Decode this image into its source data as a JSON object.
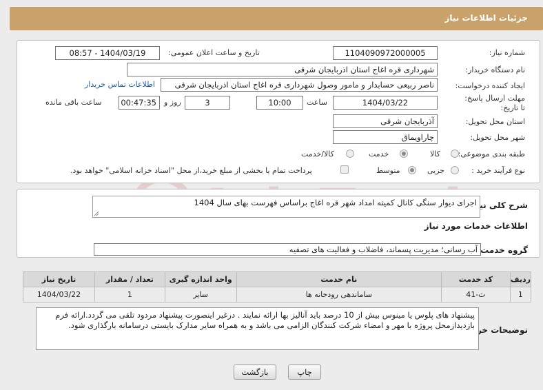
{
  "header": {
    "title": "جزئیات اطلاعات نیاز"
  },
  "form": {
    "need_number_label": "شماره نیاز:",
    "need_number": "1104090972000005",
    "announce_label": "تاریخ و ساعت اعلان عمومی:",
    "announce_value": "1404/03/19 - 08:57",
    "buyer_label": "نام دستگاه خریدار:",
    "buyer_value": "شهرداری قره اغاج استان اذربایجان شرقی",
    "creator_label": "ایجاد کننده درخواست:",
    "creator_value": "ناصر  ربیعی  حسابدار و مامور وصول  شهرداری قره اغاج استان اذربایجان شرقی",
    "contact_link": "اطلاعات تماس خریدار",
    "deadline_label": "مهلت ارسال پاسخ: تا تاریخ:",
    "deadline_date": "1404/03/22",
    "time_label": "ساعت",
    "deadline_time": "10:00",
    "days_value": "3",
    "days_label": "روز و",
    "remaining_value": "00:47:35",
    "remaining_label": "ساعت باقی مانده",
    "province_label": "استان محل تحویل:",
    "province_value": "آذربایجان شرقی",
    "city_label": "شهر محل تحویل:",
    "city_value": "چاراویماق",
    "category_label": "طبقه بندی موضوعی:",
    "category_options": [
      "کالا",
      "خدمت",
      "کالا/خدمت"
    ],
    "process_label": "نوع فرآیند خرید :",
    "process_options": [
      "جزیی",
      "متوسط"
    ],
    "payment_text": "پرداخت تمام یا بخشی از مبلغ خرید،از محل \"اسناد خزانه اسلامی\" خواهد بود."
  },
  "summary": {
    "label": "شرح کلی نیاز:",
    "value": "اجرای دیوار سنگی کانال کمیته امداد شهر قره اغاج براساس فهرست بهای سال 1404"
  },
  "services": {
    "title": "اطلاعات خدمات مورد نیاز",
    "group_label": "گروه خدمت:",
    "group_value": "آب رسانی؛ مدیریت پسماند، فاضلاب و فعالیت های تصفیه",
    "columns": [
      "ردیف",
      "کد خدمت",
      "نام خدمت",
      "واحد اندازه گیری",
      "تعداد / مقدار",
      "تاریخ نیاز"
    ],
    "rows": [
      [
        "1",
        "ث-41",
        "ساماندهی رودخانه ها",
        "سایر",
        "1",
        "1404/03/22"
      ]
    ]
  },
  "notes": {
    "label": "توضیحات خریدار:",
    "value": "پیشنهاد های پلوس یا مینوس بیش از 10 درصد باید آنالیز بها ارائه نمایند . درغیر اینصورت پیشنهاد مردود تلقی می گردد.ارائه فرم بازدیدازمحل پروژه با مهر و امضاء شرکت کنندگان الزامی می باشد و به همراه سایر مدارک بایستی درسامانه بارگذاری شود."
  },
  "buttons": {
    "print": "چاپ",
    "back": "بازگشت"
  },
  "watermark": {
    "text": "AriaTender.net"
  },
  "colors": {
    "header": "#c9a16b",
    "link": "#1a58b0",
    "watermark": "#c0392b"
  }
}
